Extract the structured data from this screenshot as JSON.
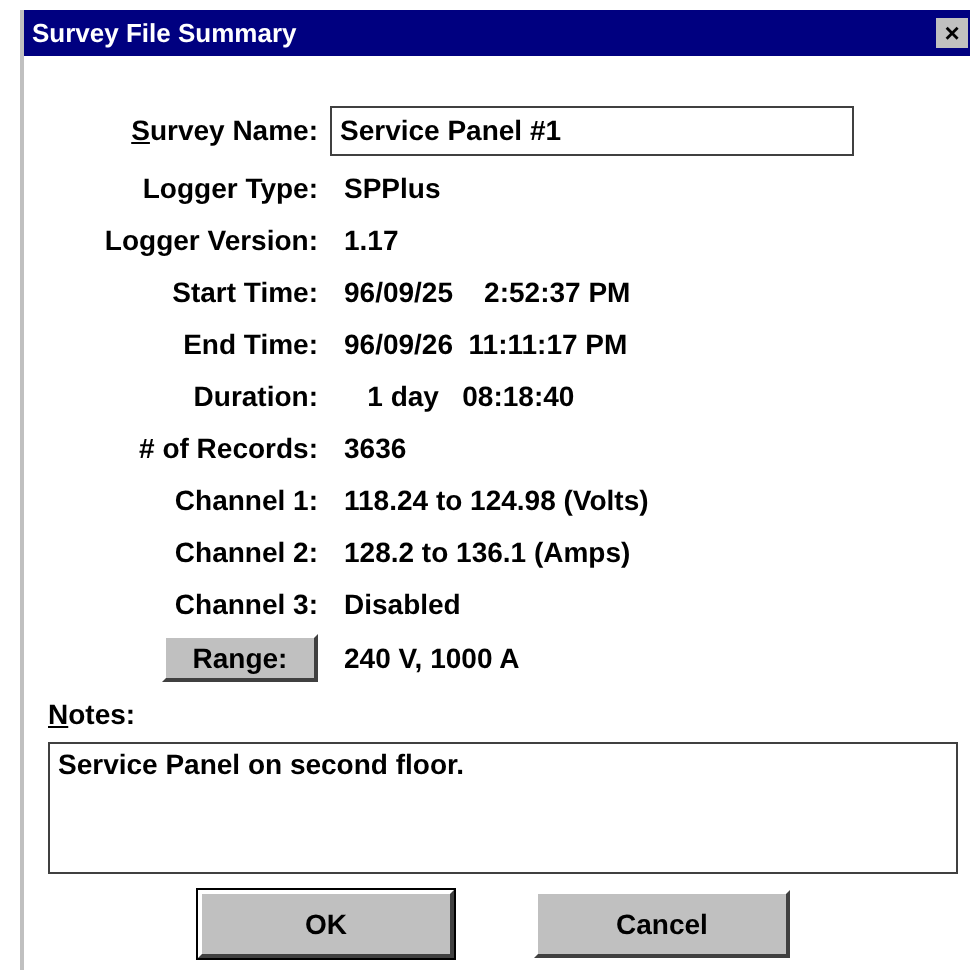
{
  "window": {
    "title": "Survey File Summary",
    "close": "×"
  },
  "survey_name": {
    "label": "Survey Name:",
    "value": "Service Panel #1"
  },
  "fields": [
    {
      "label": "Logger Type:",
      "value": "SPPlus"
    },
    {
      "label": "Logger Version:",
      "value": "1.17"
    },
    {
      "label": "Start Time:",
      "value": "96/09/25    2:52:37 PM"
    },
    {
      "label": "End Time:",
      "value": "96/09/26  11:11:17 PM"
    },
    {
      "label": "Duration:",
      "value": "   1 day   08:18:40"
    },
    {
      "label": "# of Records:",
      "value": "3636"
    },
    {
      "label": "Channel 1:",
      "value": "118.24 to 124.98 (Volts)"
    },
    {
      "label": "Channel 2:",
      "value": "128.2 to 136.1 (Amps)"
    },
    {
      "label": "Channel 3:",
      "value": "Disabled"
    }
  ],
  "range": {
    "button": "Range:",
    "value": "240 V, 1000 A"
  },
  "notes": {
    "label": "Notes:",
    "value": "Service Panel on second floor."
  },
  "buttons": [
    "OK",
    "Cancel"
  ]
}
